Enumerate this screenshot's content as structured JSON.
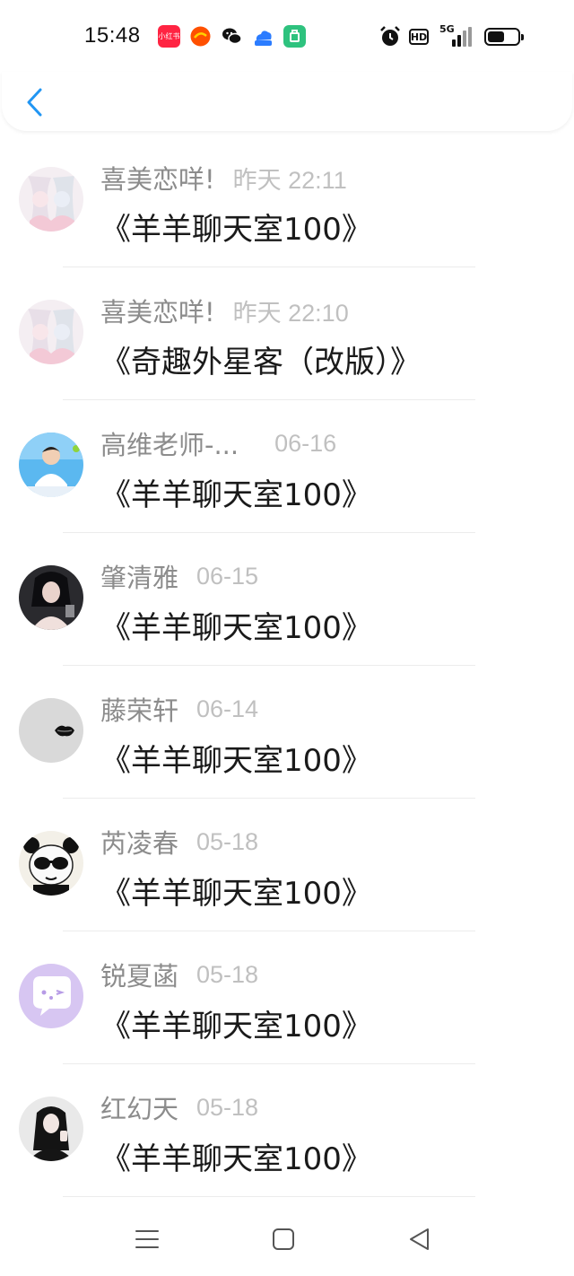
{
  "status_bar": {
    "time": "15:48",
    "app_icons": [
      {
        "name": "xiaohongshu-icon",
        "label": "小红书",
        "color": "#ff2442"
      },
      {
        "name": "taobao-icon",
        "label": "",
        "color": "#ff5000"
      },
      {
        "name": "wechat-icon",
        "label": "",
        "color": "#111111"
      },
      {
        "name": "cloud-app-icon",
        "label": "",
        "color": "#2b7cff"
      },
      {
        "name": "green-app-icon",
        "label": "",
        "color": "#2ec27e"
      }
    ],
    "hd_label": "HD",
    "network_label": "5G",
    "battery_level": 0.55
  },
  "header": {
    "back_icon": "chevron-left-icon",
    "accent_color": "#2196f3"
  },
  "items": [
    {
      "sender": "喜美恋咩!",
      "time": "昨天 22:11",
      "title": "《羊羊聊天室100》"
    },
    {
      "sender": "喜美恋咩!",
      "time": "昨天 22:10",
      "title": "《奇趣外星客（改版）》"
    },
    {
      "sender": "高维老师-...",
      "time": "06-16",
      "title": "《羊羊聊天室100》"
    },
    {
      "sender": "肇清雅",
      "time": "06-15",
      "title": "《羊羊聊天室100》"
    },
    {
      "sender": "藤荣轩",
      "time": "06-14",
      "title": "《羊羊聊天室100》"
    },
    {
      "sender": "芮凌春",
      "time": "05-18",
      "title": "《羊羊聊天室100》"
    },
    {
      "sender": "锐夏菡",
      "time": "05-18",
      "title": "《羊羊聊天室100》"
    },
    {
      "sender": "红幻天",
      "time": "05-18",
      "title": "《羊羊聊天室100》"
    }
  ],
  "bottom_nav": {
    "menu_icon": "menu-icon",
    "home_icon": "home-square-icon",
    "back_icon": "back-triangle-icon"
  }
}
